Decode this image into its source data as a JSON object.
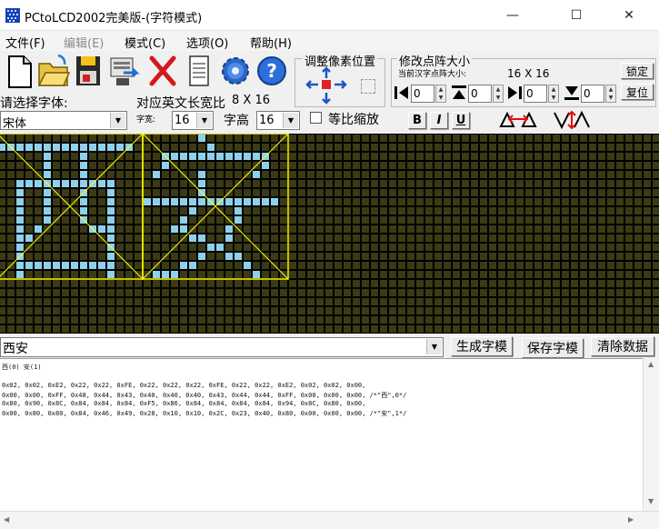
{
  "window": {
    "title": "PCtoLCD2002完美版-(字符模式)",
    "minimize_glyph": "—",
    "maximize_glyph": "☐",
    "close_glyph": "✕"
  },
  "menu": [
    {
      "label": "文件(F)",
      "enabled": true
    },
    {
      "label": "编辑(E)",
      "enabled": false
    },
    {
      "label": "模式(C)",
      "enabled": true
    },
    {
      "label": "选项(O)",
      "enabled": true
    },
    {
      "label": "帮助(H)",
      "enabled": true
    }
  ],
  "toolbar": {
    "icons": [
      "new-file-icon",
      "open-folder-icon",
      "save-floppy-icon",
      "export-icon",
      "delete-x-icon",
      "notepad-icon",
      "settings-gear-icon",
      "help-question-icon"
    ],
    "align_group_title": "调整像素位置",
    "resize_group_title": "修改点阵大小",
    "current_size_label": "当前汉字点阵大小:",
    "current_size_value": "16 X 16",
    "lock_button": "锁定",
    "restore_button": "复位",
    "resize_fields": [
      "0",
      "0",
      "0",
      "0"
    ],
    "font_prompt": "请选择字体:",
    "font_value": "宋体",
    "en_ratio_label": "对应英文长宽比",
    "en_ratio_value": "8 X 16",
    "width_label": "字宽:",
    "width_value": "16",
    "height_label": "字高",
    "height_value": "16",
    "proportional_label": "等比缩放",
    "proportional_checked": false,
    "bold_label": "B",
    "italic_label": "I",
    "underline_label": "U"
  },
  "grid": {
    "background": "#000000",
    "dot_off": "#3b3a15",
    "dot_on": "#8fd1ea",
    "frame_color": "#ffff00"
  },
  "input": {
    "text": "西安",
    "generate_button": "生成字模",
    "save_button": "保存字模",
    "clear_button": "清除数据"
  },
  "output": {
    "header": "西(0) 安(1)",
    "lines": [
      "0x02, 0x02, 0xE2, 0x22, 0x22, 0xFE, 0x22, 0x22, 0x22, 0xFE, 0x22, 0x22, 0xE2, 0x02, 0x02, 0x00,",
      "0x00, 0x00, 0xFF, 0x48, 0x44, 0x43, 0x40, 0x40, 0x40, 0x43, 0x44, 0x44, 0xFF, 0x00, 0x00, 0x00, /*\"西\",0*/",
      "0x80, 0x90, 0x8C, 0x84, 0x84, 0x84, 0xF5, 0x86, 0x84, 0x84, 0x84, 0x84, 0x94, 0x8C, 0x80, 0x00,",
      "0x00, 0x80, 0x80, 0x84, 0x46, 0x49, 0x28, 0x10, 0x10, 0x2C, 0x23, 0x40, 0x80, 0x00, 0x00, 0x00, /*\"安\",1*/"
    ]
  }
}
